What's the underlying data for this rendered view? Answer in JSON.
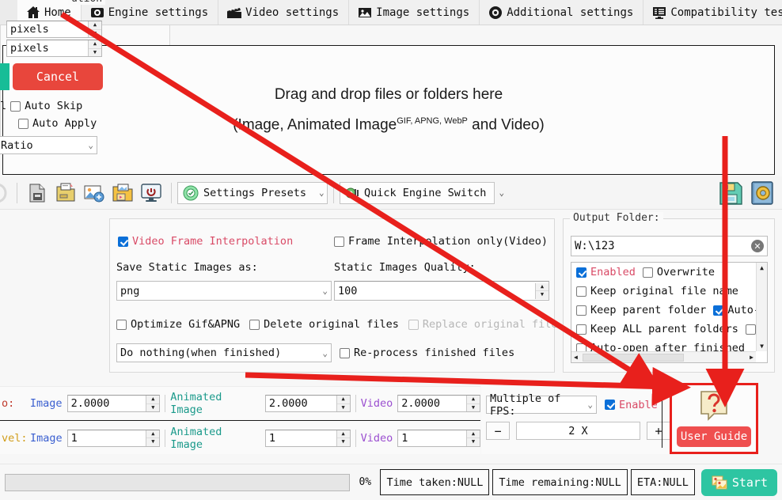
{
  "tabs": [
    {
      "label": "Home",
      "icon": "home-icon",
      "active": true
    },
    {
      "label": "Engine settings",
      "icon": "engine-gear-icon",
      "active": false
    },
    {
      "label": "Video settings",
      "icon": "clapperboard-icon",
      "active": false
    },
    {
      "label": "Image settings",
      "icon": "picture-icon",
      "active": false
    },
    {
      "label": "Additional settings",
      "icon": "cog-icon",
      "active": false
    },
    {
      "label": "Compatibility test",
      "icon": "monitor-checklist-icon",
      "active": false
    }
  ],
  "drop_area": {
    "line1": "Drag and drop files or folders here",
    "line2_pre": "(Image, Animated Image",
    "line2_sup": "GIF, APNG, WebP",
    "line2_post": " and Video)"
  },
  "toolbar": {
    "icons": [
      "save-file-icon",
      "open-folder-icon",
      "add-image-icon",
      "media-folder-icon",
      "power-icon"
    ],
    "settings_presets": "Settings Presets",
    "settings_presets_icon": "settings-check-icon",
    "quick_engine_switch": "Quick Engine Switch",
    "quick_engine_icon": "engine-switch-icon",
    "right_icons": [
      "save-disk-icon",
      "config-book-icon"
    ],
    "chevron": "⌄"
  },
  "left_panel": {
    "title_partial": "ution",
    "width_value": "pixels",
    "height_value": "pixels",
    "cancel_label": "Cancel",
    "auto_skip": "Auto Skip",
    "auto_skip_checked": false,
    "auto_apply": "Auto Apply",
    "auto_apply_checked": false,
    "ratio_select": "Ratio"
  },
  "middle_panel": {
    "video_frame_interpolation": "Video Frame Interpolation",
    "video_frame_interpolation_checked": true,
    "frame_interpolation_only": "Frame Interpolation only(Video)",
    "frame_interpolation_only_checked": false,
    "save_static_label": "Save Static Images as:",
    "save_static_value": "png",
    "quality_label": "Static Images Quality:",
    "quality_value": "100",
    "optimize_gif": "Optimize Gif&APNG",
    "optimize_gif_checked": false,
    "delete_original": "Delete original files",
    "delete_original_checked": false,
    "replace_original": "Replace original file",
    "replace_original_checked": false,
    "replace_original_disabled": true,
    "when_finished_value": "Do nothing(when finished)",
    "reprocess": "Re-process finished files",
    "reprocess_checked": false
  },
  "output_panel": {
    "title": "Output Folder:",
    "path_value": "W:\\123",
    "clear_icon": "clear-x-icon",
    "options": [
      {
        "label": "Enabled",
        "checked": true,
        "accent": "#d94a66"
      },
      {
        "label": "Overwrite",
        "checked": false
      },
      {
        "label": "Keep original file name",
        "checked": false
      },
      {
        "label": "Keep parent folder",
        "checked": false
      },
      {
        "label": "Auto-C",
        "checked": true
      },
      {
        "label": "Keep ALL parent folders",
        "checked": false
      },
      {
        "label": "",
        "checked": false
      },
      {
        "label": "Auto-open after finished",
        "checked": false
      }
    ]
  },
  "ratio_rows": {
    "row1": {
      "prefix": "o:",
      "image_label": "Image",
      "image_value": "2.0000",
      "anim_label": "Animated Image",
      "anim_value": "2.0000",
      "video_label": "Video",
      "video_value": "2.0000"
    },
    "row2": {
      "prefix": "vel:",
      "image_label": "Image",
      "image_value": "1",
      "anim_label": "Animated Image",
      "anim_value": "1",
      "video_label": "Video",
      "video_value": "1"
    }
  },
  "fps_box": {
    "multiple_label": "Multiple of FPS:",
    "enable_label": "Enable",
    "enable_checked": true,
    "minus": "−",
    "plus": "+",
    "x_value": "2 X"
  },
  "user_guide": {
    "label": "User Guide",
    "icon": "question-card-icon"
  },
  "bottom": {
    "percent": "0%",
    "progress_value": 0,
    "time_taken": "Time taken:NULL",
    "time_remaining": "Time remaining:NULL",
    "eta": "ETA:NULL",
    "start_label": "Start",
    "start_icon": "images-icon"
  },
  "annotations": {
    "arrow_color": "#e8201c"
  }
}
